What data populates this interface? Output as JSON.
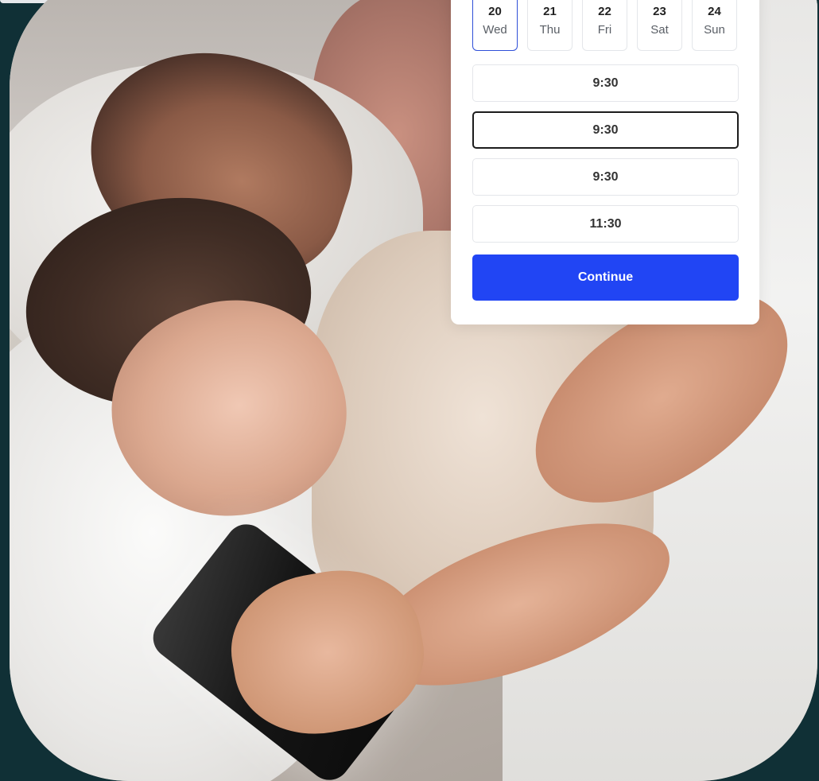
{
  "booking": {
    "days": [
      {
        "num": "20",
        "name": "Wed",
        "selected": true
      },
      {
        "num": "21",
        "name": "Thu",
        "selected": false
      },
      {
        "num": "22",
        "name": "Fri",
        "selected": false
      },
      {
        "num": "23",
        "name": "Sat",
        "selected": false
      },
      {
        "num": "24",
        "name": "Sun",
        "selected": false
      }
    ],
    "times": [
      {
        "label": "9:30",
        "selected": false
      },
      {
        "label": "9:30",
        "selected": true
      },
      {
        "label": "9:30",
        "selected": false
      },
      {
        "label": "11:30",
        "selected": false
      }
    ],
    "continue_label": "Continue"
  },
  "colors": {
    "background": "#103036",
    "accent": "#2145f4",
    "selected_day_border": "#2f4fd8"
  }
}
